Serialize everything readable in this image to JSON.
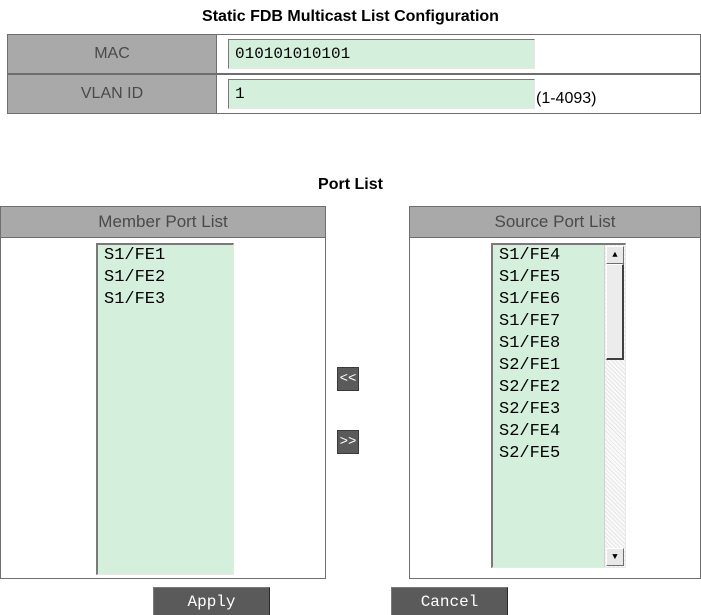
{
  "form": {
    "title": "Static FDB Multicast List Configuration",
    "mac_label": "MAC",
    "mac_value": "010101010101",
    "vlan_label": "VLAN ID",
    "vlan_value": "1",
    "vlan_hint": "(1-4093)"
  },
  "port_list": {
    "title": "Port List",
    "member_header": "Member Port List",
    "member_items": [
      "S1/FE1",
      "S1/FE2",
      "S1/FE3"
    ],
    "source_header": "Source Port List",
    "source_items": [
      "S1/FE4",
      "S1/FE5",
      "S1/FE6",
      "S1/FE7",
      "S1/FE8",
      "S2/FE1",
      "S2/FE2",
      "S2/FE3",
      "S2/FE4",
      "S2/FE5"
    ],
    "move_left_label": "<<",
    "move_right_label": ">>"
  },
  "actions": {
    "apply_label": "Apply",
    "cancel_label": "Cancel"
  },
  "colors": {
    "header_bg": "#a9a9a9",
    "input_bg": "#d4f0dc",
    "button_bg": "#5a5a5a"
  },
  "icons": {
    "scroll_up": "scroll-up-arrow-icon",
    "scroll_down": "scroll-down-arrow-icon"
  }
}
